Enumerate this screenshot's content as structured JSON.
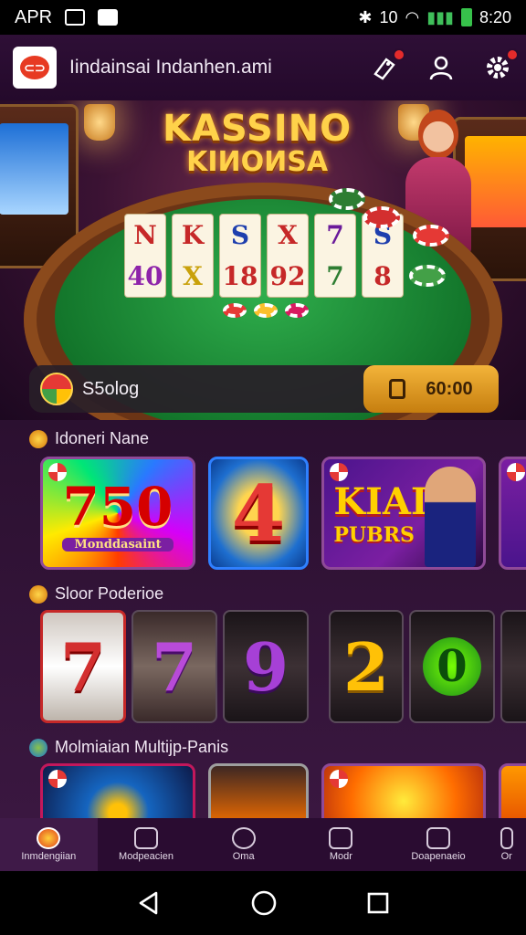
{
  "status_bar": {
    "left_text": "APR",
    "time": "8:20",
    "signal_text": "10"
  },
  "header": {
    "logo_text": "⊂⊃",
    "title": "Iindainsai Indanhen.ami"
  },
  "hero": {
    "title_line1": "KASSINO",
    "title_line2": "KIИOИSA",
    "cards": [
      [
        "N",
        "40"
      ],
      [
        "K",
        "X"
      ],
      [
        "S",
        "18"
      ],
      [
        "X",
        "92"
      ],
      [
        "7",
        "7"
      ],
      [
        "S",
        "8"
      ]
    ]
  },
  "balance": {
    "label": "S5olog",
    "deposit_amount": "60:00"
  },
  "sections": [
    {
      "title": "Idoneri Nane",
      "tiles": [
        {
          "text": "750",
          "sub": "Monddasaint"
        },
        {
          "text": "4",
          "sub": ""
        },
        {
          "text": "KIAI",
          "sub": "PUBRS"
        },
        {
          "text": "",
          "sub": ""
        }
      ]
    },
    {
      "title": "Sloor Poderioe",
      "reels": [
        "7",
        "7",
        "9",
        "2",
        "0",
        ""
      ]
    },
    {
      "title": "Molmiaian Multijp-Panis"
    }
  ],
  "bottom_nav": [
    {
      "label": "Inmdengiian"
    },
    {
      "label": "Modpeacien"
    },
    {
      "label": "Oma"
    },
    {
      "label": "Modr"
    },
    {
      "label": "Doapenaeio"
    },
    {
      "label": "Or"
    }
  ],
  "colors": {
    "accent": "#f3b43a",
    "header_bg": "#2e0f36",
    "content_bg": "#2b1030"
  }
}
